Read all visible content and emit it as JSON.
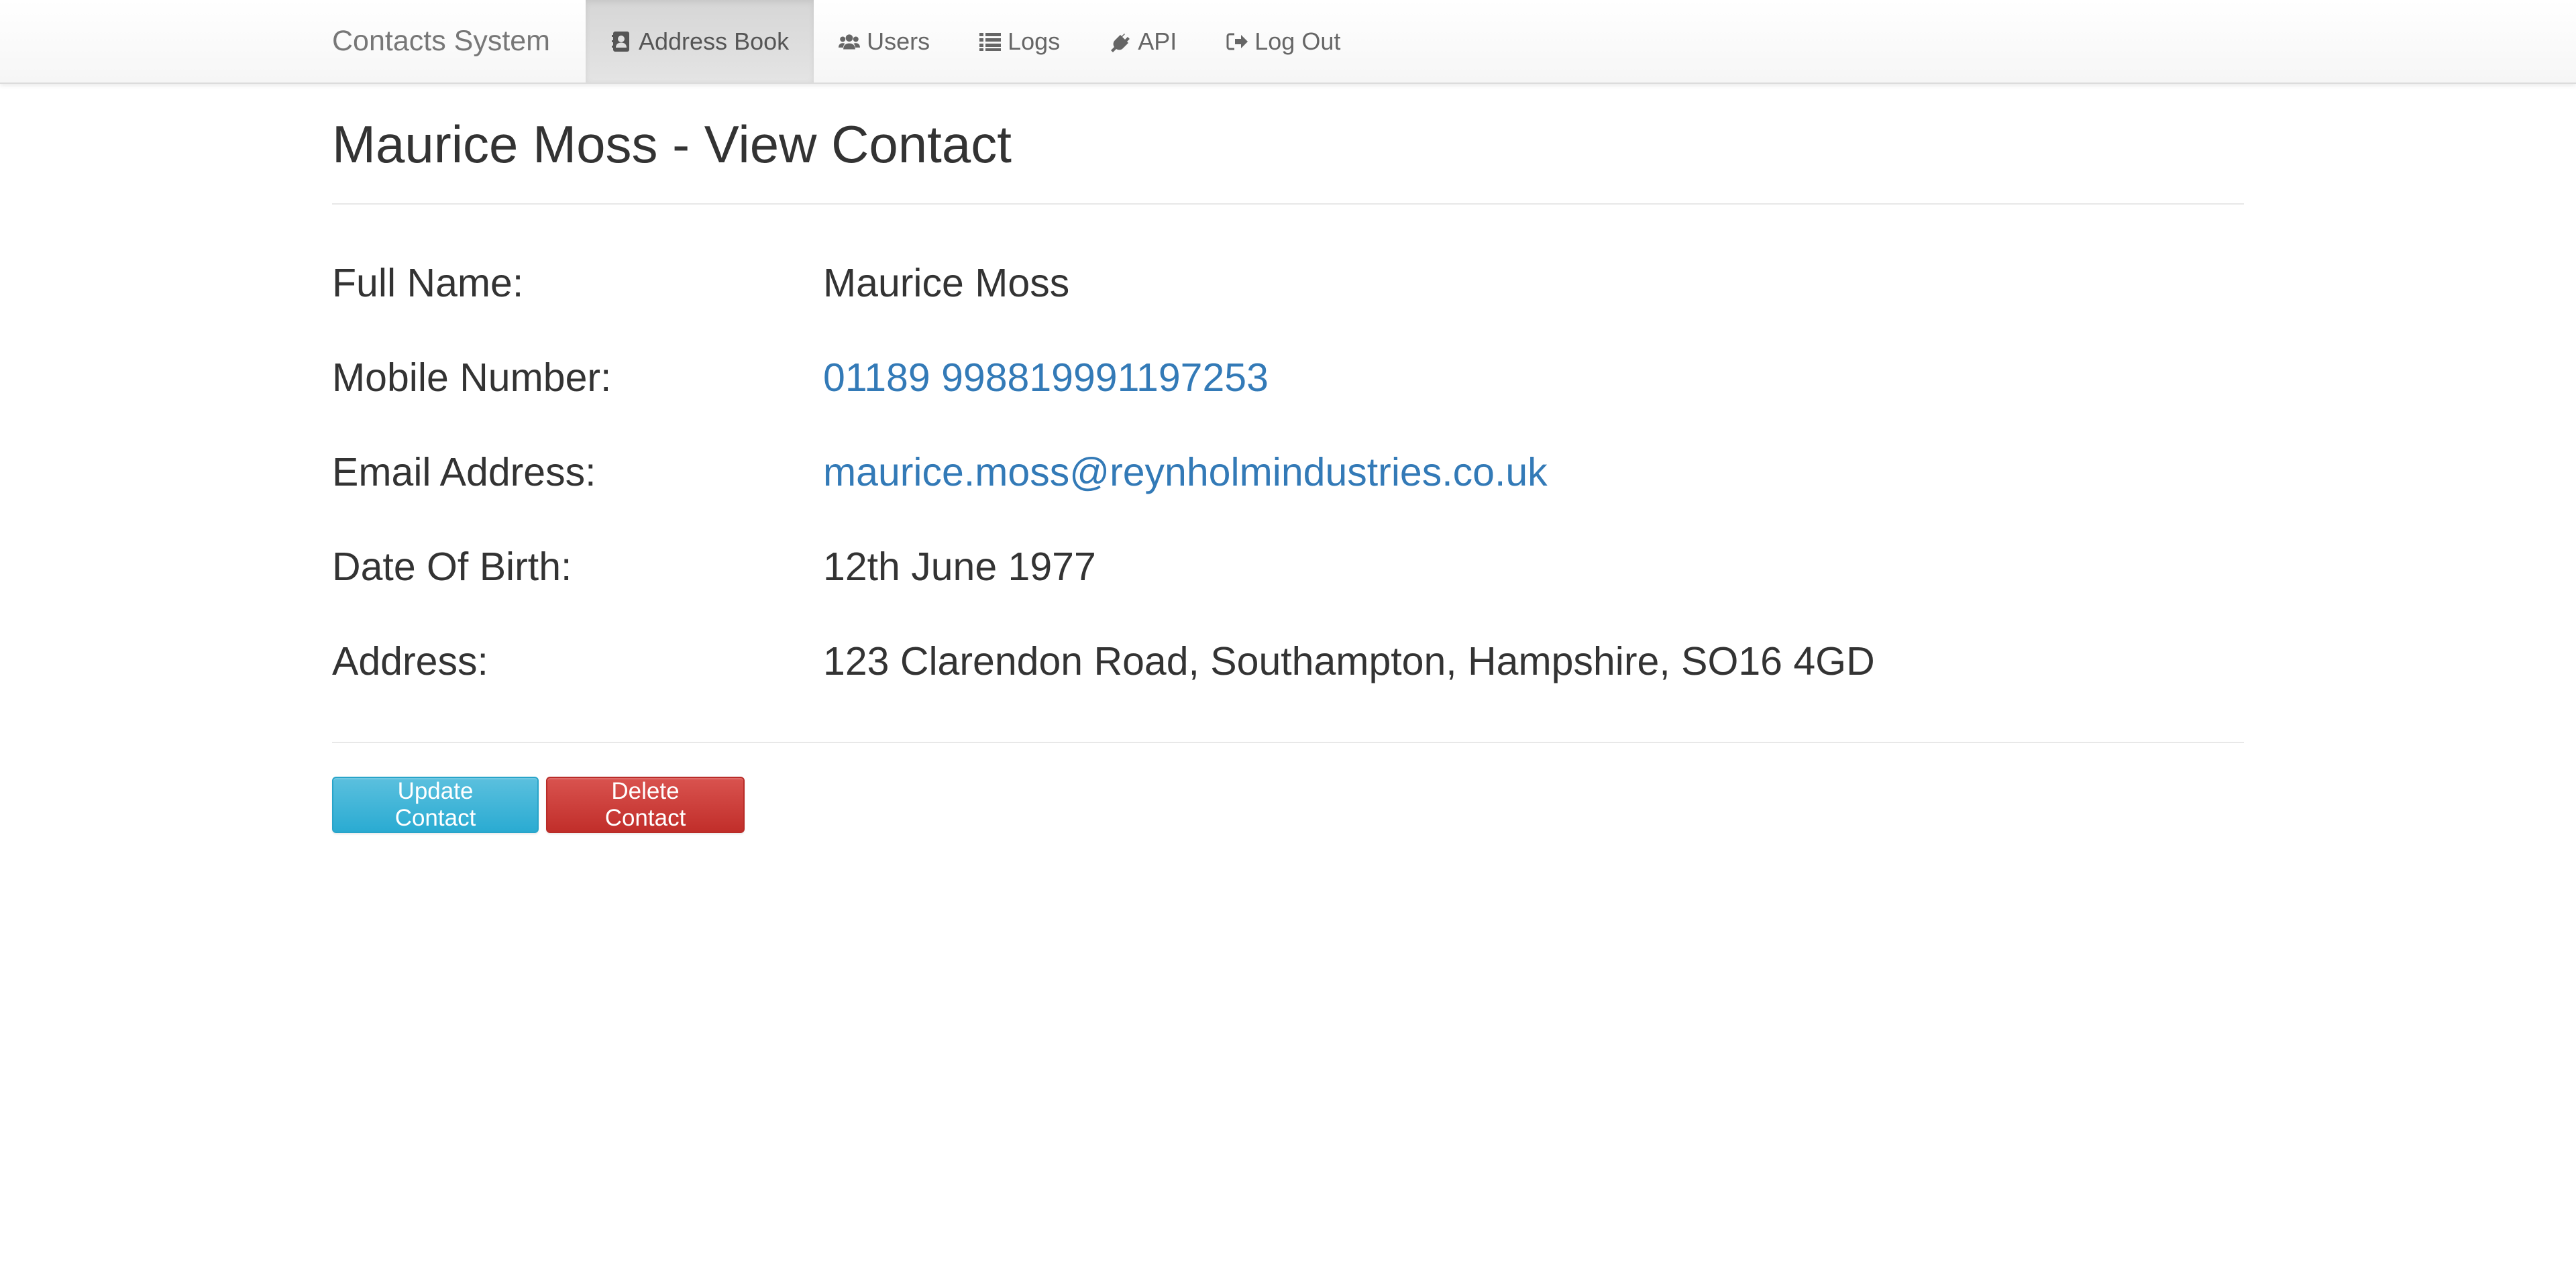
{
  "navbar": {
    "brand": "Contacts System",
    "items": [
      {
        "label": "Address Book",
        "icon": "address-book-icon",
        "active": true
      },
      {
        "label": "Users",
        "icon": "users-icon",
        "active": false
      },
      {
        "label": "Logs",
        "icon": "list-icon",
        "active": false
      },
      {
        "label": "API",
        "icon": "plug-icon",
        "active": false
      },
      {
        "label": "Log Out",
        "icon": "sign-out-icon",
        "active": false
      }
    ]
  },
  "page": {
    "title": "Maurice Moss - View Contact"
  },
  "contact": {
    "fields": [
      {
        "label": "Full Name:",
        "value": "Maurice Moss"
      },
      {
        "label": "Mobile Number:",
        "value": "01189 998819991197253"
      },
      {
        "label": "Email Address:",
        "value": "maurice.moss@reynholmindustries.co.uk"
      },
      {
        "label": "Date Of Birth:",
        "value": "12th June 1977"
      },
      {
        "label": "Address:",
        "value": "123 Clarendon Road, Southampton, Hampshire, SO16 4GD"
      }
    ]
  },
  "actions": {
    "update_label": "Update Contact",
    "delete_label": "Delete Contact"
  },
  "colors": {
    "link": "#337ab7",
    "info": "#31b0d5",
    "danger": "#c9302c",
    "nav_active_bg": "#dcdcdc"
  }
}
